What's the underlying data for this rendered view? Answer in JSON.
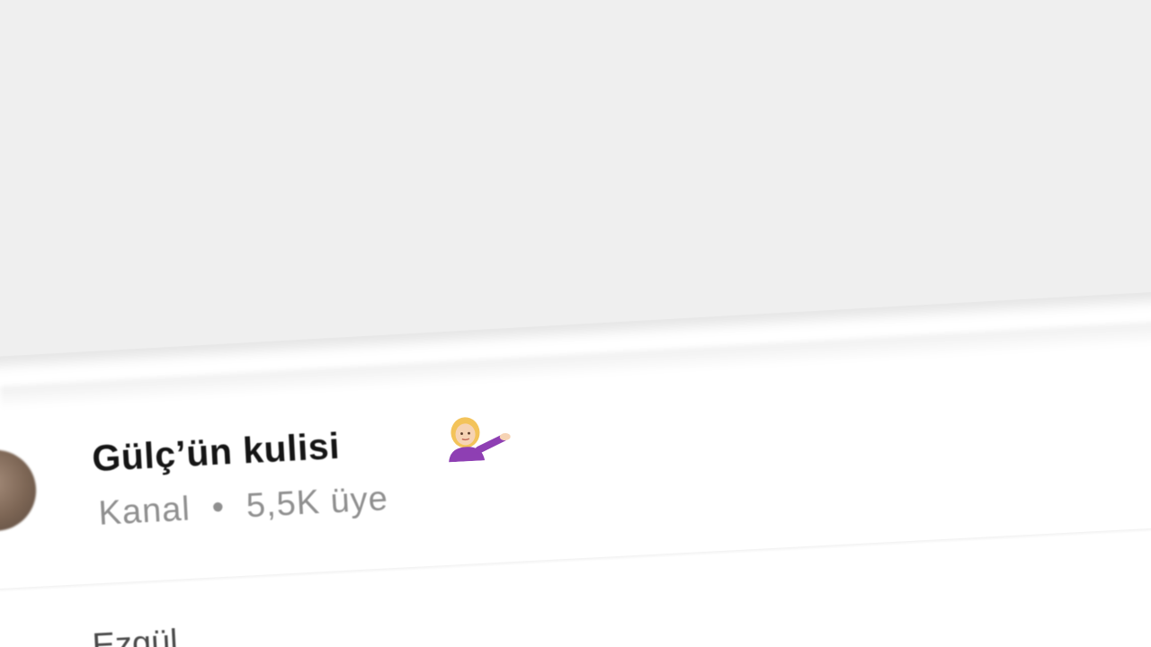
{
  "channel": {
    "title": "Gülç’ün kulisi",
    "emoji_icon": "person-tipping-hand-icon",
    "type_label": "Kanal",
    "separator": "•",
    "member_count": "5,5K üye"
  },
  "next_row": {
    "text": "...Ezgül"
  },
  "colors": {
    "background_top": "#efefef",
    "background_bottom": "#ffffff",
    "title_text": "#151515",
    "subtitle_text": "#8f8f8f"
  }
}
